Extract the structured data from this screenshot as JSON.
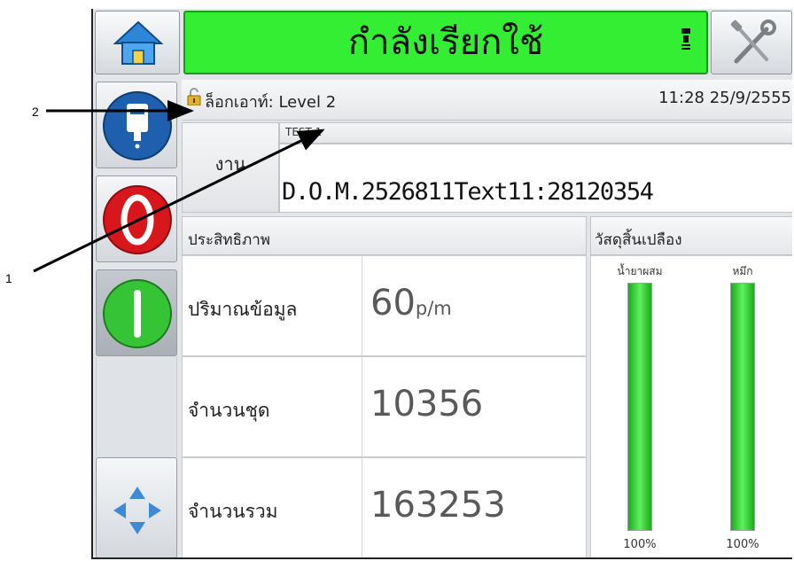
{
  "callouts": {
    "one": "1",
    "two": "2"
  },
  "status": {
    "text": "กำลังเรียกใช้"
  },
  "info": {
    "lock_text": "ล็อกเอาท์: Level 2",
    "clock": "11:28 25/9/2555"
  },
  "job": {
    "label": "งาน",
    "name": "TEST 1",
    "message": "D.O.M.2526811Text11:28120354"
  },
  "performance": {
    "title": "ประสิทธิภาพ",
    "rows": [
      {
        "label": "ปริมาณข้อมูล",
        "value": "60",
        "unit": "p/m"
      },
      {
        "label": "จำนวนชุด",
        "value": "10356",
        "unit": ""
      },
      {
        "label": "จำนวนรวม",
        "value": "163253",
        "unit": ""
      }
    ]
  },
  "consumables": {
    "title": "วัสดุสิ้นเปลือง",
    "items": [
      {
        "label": "น้ำยาผสม",
        "percent": "100%",
        "level": 1.0
      },
      {
        "label": "หมึก",
        "percent": "100%",
        "level": 1.0
      }
    ]
  },
  "icons": {
    "home": "home-icon",
    "tools": "tools-icon",
    "printhead": "printhead-icon",
    "stop": "stop-icon",
    "start": "start-icon",
    "navigate": "navigate-arrows-icon",
    "lock": "lock-icon",
    "ink-drop": "ink-status-icon"
  },
  "colors": {
    "status_running": "#33ee33",
    "stop_red": "#d8171c",
    "start_green": "#35c435",
    "printhead_blue": "#1e5fae",
    "gauge_green": "#3ad83a"
  }
}
